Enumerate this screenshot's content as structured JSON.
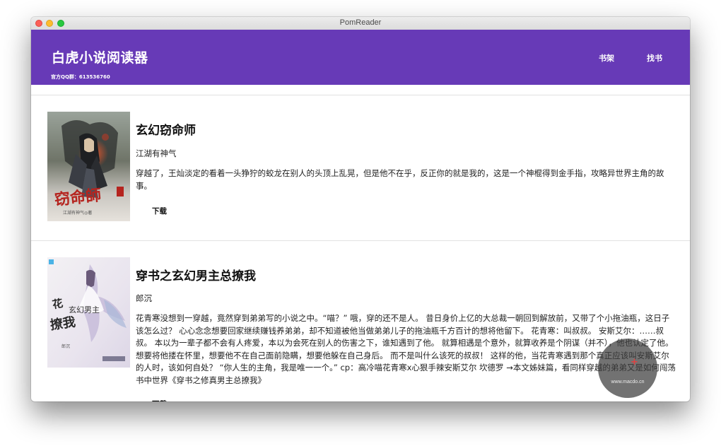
{
  "window": {
    "title": "PomReader"
  },
  "header": {
    "app_title": "白虎小说阅读器",
    "qq_group": "官方QQ群：613536760",
    "nav": [
      {
        "label": "书架"
      },
      {
        "label": "找书"
      }
    ],
    "color": "#673ab7"
  },
  "books": [
    {
      "title": "玄幻窃命师",
      "author": "江湖有神气",
      "description": "穿越了，王灿淡定的看着一头狰狞的蛟龙在别人的头顶上乱晃，但是他不在乎，反正你的就是我的，这是一个神棍得到金手指，攻略异世界主角的故事。",
      "download_label": "下载",
      "cover": {
        "title_text": "窃命师",
        "author_text": "江湖有神气◎著"
      }
    },
    {
      "title": "穿书之玄幻男主总撩我",
      "author": "郎沉",
      "description": "花青寒没想到一穿越，竟然穿到弟弟写的小说之中。“喵？” 哦，穿的还不是人。 昔日身价上亿的大总裁一朝回到解放前，又带了个小拖油瓶，这日子该怎么过？ 心心念念想要回家继续赚钱养弟弟，却不知道被他当做弟弟儿子的拖油瓶千方百计的想将他留下。 花青寒：叫叔叔。 安斯艾尔：……叔叔。 本以为一辈子都不会有人疼爱，本以为会死在别人的伤害之下，谁知遇到了他。 就算相遇是个意外，就算收养是个阴谋（并不），他也认定了他。 想要将他搂在怀里，想要他不在自己面前隐瞒，想要他躲在自己身后。 而不是叫什么该死的叔叔！ 这样的他，当花青寒遇到那个真正应该叫安斯艾尔的人时，该如何自处？ “你人生的主角，我是唯一一个。” cp：高冷喵花青寒x心狠手辣安斯艾尔 坎德罗 →本文姊妹篇，看同样穿越的弟弟又是如何闯荡书中世界《穿书之修真男主总撩我》",
      "download_label": "下载",
      "cover": {
        "title_text": "穿书之玄幻男主总撩我",
        "author_text": "郎沉"
      }
    }
  ],
  "watermark": {
    "text": "www.macdo.cn"
  }
}
